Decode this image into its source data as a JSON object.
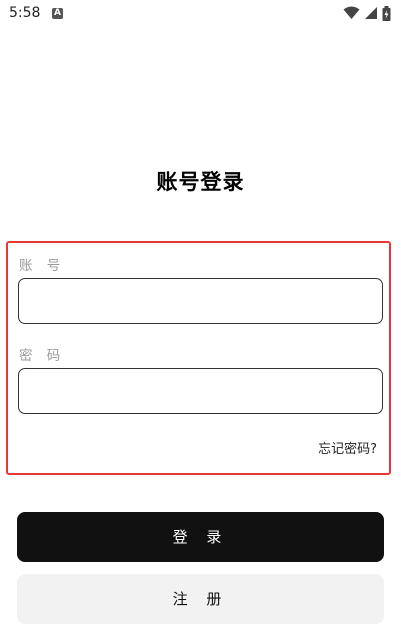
{
  "status_bar": {
    "time": "5:58",
    "notification_icon": "A",
    "icons": [
      "wifi-icon",
      "signal-icon",
      "battery-icon"
    ]
  },
  "page": {
    "title": "账号登录"
  },
  "form": {
    "account_label": "账 号",
    "account_value": "",
    "password_label": "密 码",
    "password_value": "",
    "forgot_password": "忘记密码?"
  },
  "buttons": {
    "login": "登 录",
    "register": "注 册"
  },
  "colors": {
    "highlight_border": "#e53935",
    "primary_button": "#111111",
    "secondary_button": "#f2f2f2"
  }
}
